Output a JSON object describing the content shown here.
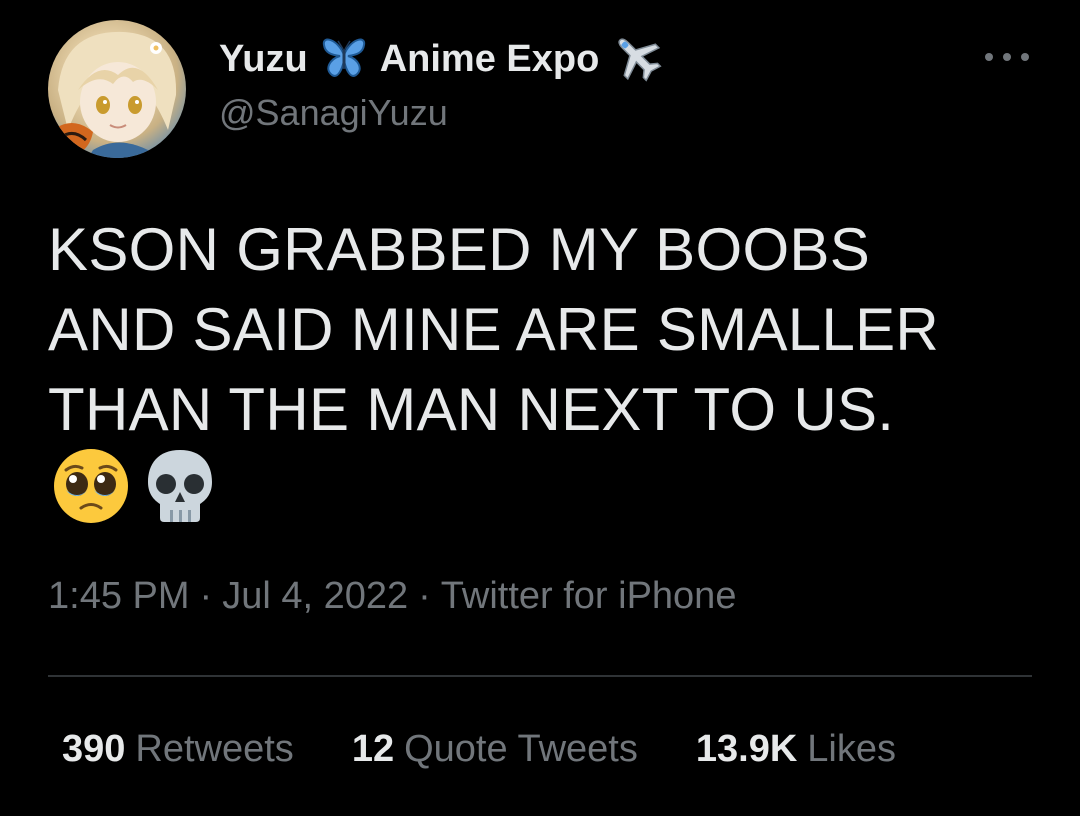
{
  "author": {
    "name_part1": "Yuzu",
    "name_emoji1": "butterfly-emoji",
    "name_part2": "Anime Expo",
    "name_emoji2": "airplane-emoji",
    "handle": "@SanagiYuzu"
  },
  "tweet": {
    "lines": [
      "KSON GRABBED MY BOOBS",
      "AND SAID MINE ARE SMALLER",
      "THAN THE MAN NEXT TO US."
    ],
    "emojis": [
      "pleading-face-emoji",
      "skull-emoji"
    ]
  },
  "meta": {
    "time": "1:45 PM",
    "separator": "·",
    "date": "Jul 4, 2022",
    "source": "Twitter for iPhone"
  },
  "stats": {
    "retweets_count": "390",
    "retweets_label": "Retweets",
    "quotes_count": "12",
    "quotes_label": "Quote Tweets",
    "likes_count": "13.9K",
    "likes_label": "Likes"
  },
  "colors": {
    "background": "#000000",
    "text_primary": "#e7e9ea",
    "text_secondary": "#71767b",
    "divider": "#2f3336"
  }
}
